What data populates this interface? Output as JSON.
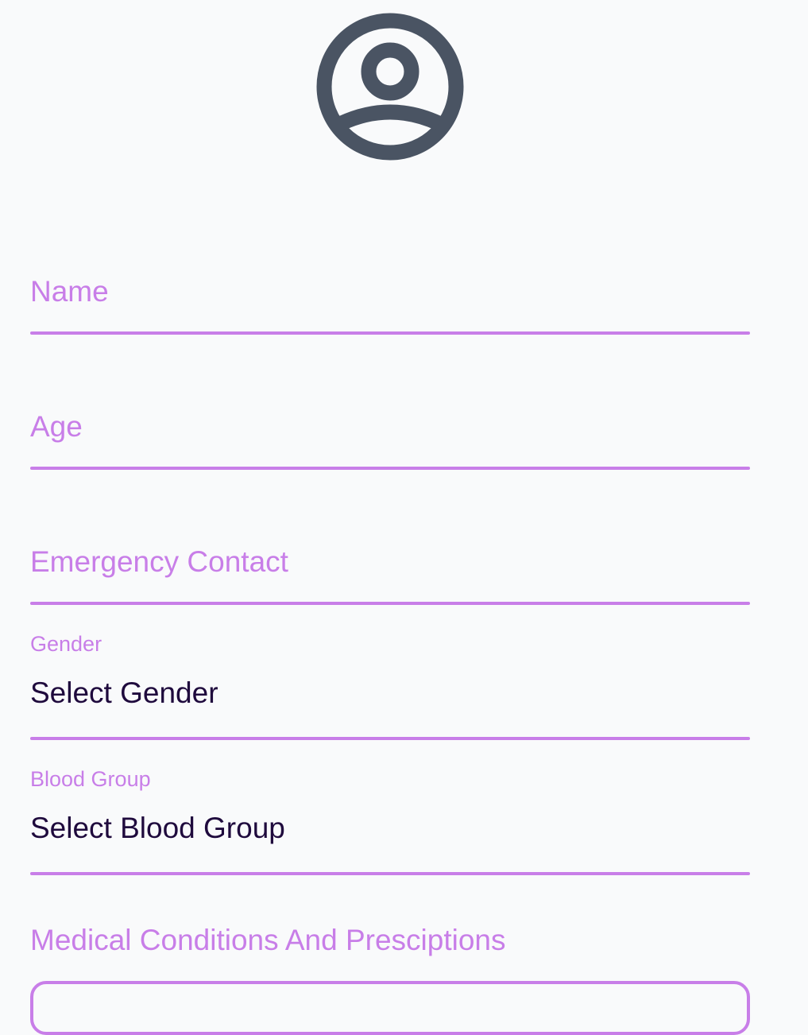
{
  "colors": {
    "accent": "#c87ee8",
    "value_text": "#1f0a3d",
    "icon": "#4a5463",
    "background": "#f9fafb"
  },
  "avatar": {
    "icon": "user-circle-icon"
  },
  "fields": {
    "name": {
      "placeholder": "Name"
    },
    "age": {
      "placeholder": "Age"
    },
    "emergency_contact": {
      "placeholder": "Emergency Contact"
    },
    "gender": {
      "label": "Gender",
      "value": "Select Gender"
    },
    "blood_group": {
      "label": "Blood Group",
      "value": "Select Blood Group"
    }
  },
  "medical": {
    "label": "Medical Conditions And Presciptions"
  }
}
